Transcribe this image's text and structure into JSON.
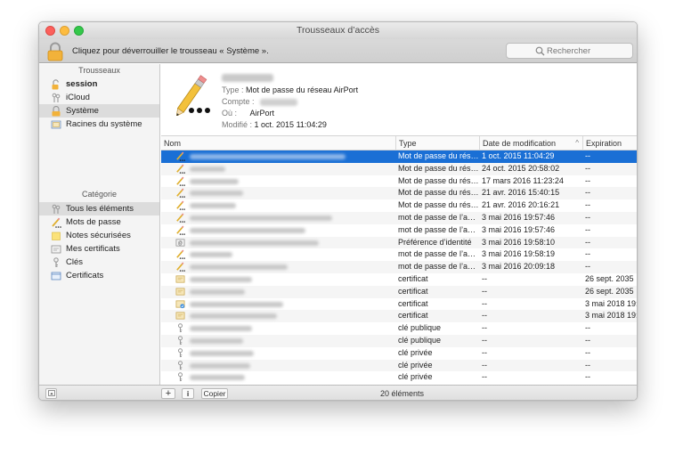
{
  "window": {
    "title": "Trousseaux d’accès"
  },
  "toolbar": {
    "unlock_text": "Cliquez pour déverrouiller le trousseau « Système ».",
    "search_placeholder": "Rechercher"
  },
  "sidebar": {
    "keychains_header": "Trousseaux",
    "keychains": [
      {
        "label": "session",
        "icon": "unlocked-padlock-icon"
      },
      {
        "label": "iCloud",
        "icon": "keys-icon"
      },
      {
        "label": "Système",
        "icon": "locked-padlock-icon"
      },
      {
        "label": "Racines du système",
        "icon": "certificates-folder-icon"
      }
    ],
    "category_header": "Catégorie",
    "categories": [
      {
        "label": "Tous les éléments",
        "icon": "keys-icon"
      },
      {
        "label": "Mots de passe",
        "icon": "pencil-icon"
      },
      {
        "label": "Notes sécurisées",
        "icon": "note-icon"
      },
      {
        "label": "Mes certificats",
        "icon": "my-certificate-icon"
      },
      {
        "label": "Clés",
        "icon": "key-icon"
      },
      {
        "label": "Certificats",
        "icon": "certificate-icon"
      }
    ]
  },
  "detail": {
    "type_label": "Type :",
    "type_value": "Mot de passe du réseau AirPort",
    "account_label": "Compte :",
    "where_label": "Où :",
    "where_value": "AirPort",
    "modified_label": "Modifié :",
    "modified_value": "1 oct. 2015 11:04:29"
  },
  "table": {
    "columns": {
      "name": "Nom",
      "type": "Type",
      "date": "Date de modification",
      "date_sort": "^",
      "expiration": "Expiration"
    },
    "rows": [
      {
        "icon": "pencil-icon",
        "type": "Mot de passe du rés…",
        "date": "1 oct. 2015 11:04:29",
        "exp": "--"
      },
      {
        "icon": "pencil-icon",
        "type": "Mot de passe du rés…",
        "date": "24 oct. 2015 20:58:02",
        "exp": "--"
      },
      {
        "icon": "pencil-icon",
        "type": "Mot de passe du rés…",
        "date": "17 mars 2016 11:23:24",
        "exp": "--"
      },
      {
        "icon": "pencil-icon",
        "type": "Mot de passe du rés…",
        "date": "21 avr. 2016 15:40:15",
        "exp": "--"
      },
      {
        "icon": "pencil-icon",
        "type": "Mot de passe du rés…",
        "date": "21 avr. 2016 20:16:21",
        "exp": "--"
      },
      {
        "icon": "pencil-icon",
        "type": "mot de passe de l’a…",
        "date": "3 mai 2016 19:57:46",
        "exp": "--"
      },
      {
        "icon": "pencil-icon",
        "type": "mot de passe de l’a…",
        "date": "3 mai 2016 19:57:46",
        "exp": "--"
      },
      {
        "icon": "identity-preference-icon",
        "type": "Préférence d’identité",
        "date": "3 mai 2016 19:58:10",
        "exp": "--"
      },
      {
        "icon": "pencil-icon",
        "type": "mot de passe de l’a…",
        "date": "3 mai 2016 19:58:19",
        "exp": "--"
      },
      {
        "icon": "pencil-icon",
        "type": "mot de passe de l’a…",
        "date": "3 mai 2016 20:09:18",
        "exp": "--"
      },
      {
        "icon": "certificate-icon",
        "type": "certificat",
        "date": "--",
        "exp": "26 sept. 2035"
      },
      {
        "icon": "certificate-icon",
        "type": "certificat",
        "date": "--",
        "exp": "26 sept. 2035"
      },
      {
        "icon": "certificate-blue-icon",
        "type": "certificat",
        "date": "--",
        "exp": "3 mai 2018 19:"
      },
      {
        "icon": "certificate-icon",
        "type": "certificat",
        "date": "--",
        "exp": "3 mai 2018 19:"
      },
      {
        "icon": "key-icon",
        "type": "clé publique",
        "date": "--",
        "exp": "--"
      },
      {
        "icon": "key-icon",
        "type": "clé publique",
        "date": "--",
        "exp": "--"
      },
      {
        "icon": "key-icon",
        "type": "clé privée",
        "date": "--",
        "exp": "--"
      },
      {
        "icon": "key-icon",
        "type": "clé privée",
        "date": "--",
        "exp": "--"
      },
      {
        "icon": "key-icon",
        "type": "clé privée",
        "date": "--",
        "exp": "--"
      }
    ]
  },
  "bottombar": {
    "add": "+",
    "info": "i",
    "copy": "Copier",
    "count": "20 éléments"
  },
  "colors": {
    "selection": "#1a6fd5",
    "lock": "#f2b23a"
  }
}
